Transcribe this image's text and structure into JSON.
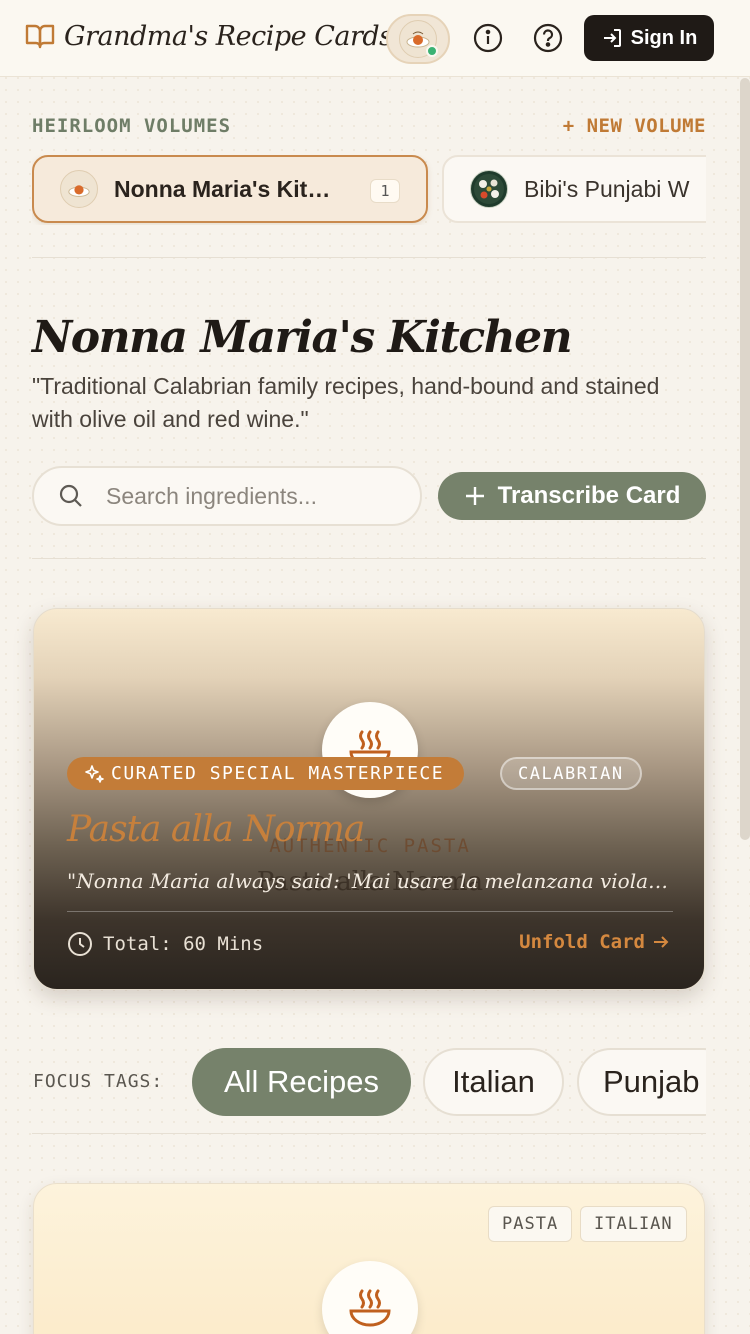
{
  "app": {
    "title": "Grandma's Recipe Cards",
    "sign_in_label": "Sign In",
    "accent": "#c37c38",
    "sage": "#76826b"
  },
  "volumes": {
    "section_label": "HEIRLOOM VOLUMES",
    "new_label": "+ NEW VOLUME",
    "items": [
      {
        "name": "Nonna Maria's Kit…",
        "count": "1",
        "active": true
      },
      {
        "name": "Bibi's Punjabi W",
        "active": false
      }
    ]
  },
  "volume": {
    "title": "Nonna Maria's Kitchen",
    "description": "\"Traditional Calabrian family recipes, hand-bound and stained with olive oil and red wine.\""
  },
  "search": {
    "placeholder": "Search ingredients...",
    "value": ""
  },
  "transcribe_label": "Transcribe Card",
  "featured": {
    "badge": "CURATED SPECIAL MASTERPIECE",
    "region": "CALABRIAN",
    "category": "AUTHENTIC PASTA",
    "title": "Pasta alla Norma",
    "quote": "\"Nonna Maria always said: 'Mai usare la melanzana viola scuro …",
    "time": "Total: 60 Mins",
    "unfold_label": "Unfold Card"
  },
  "tags": {
    "label": "FOCUS TAGS:",
    "items": [
      "All Recipes",
      "Italian",
      "Punjab"
    ]
  },
  "recipe_card": {
    "tags": [
      "PASTA",
      "ITALIAN"
    ]
  }
}
